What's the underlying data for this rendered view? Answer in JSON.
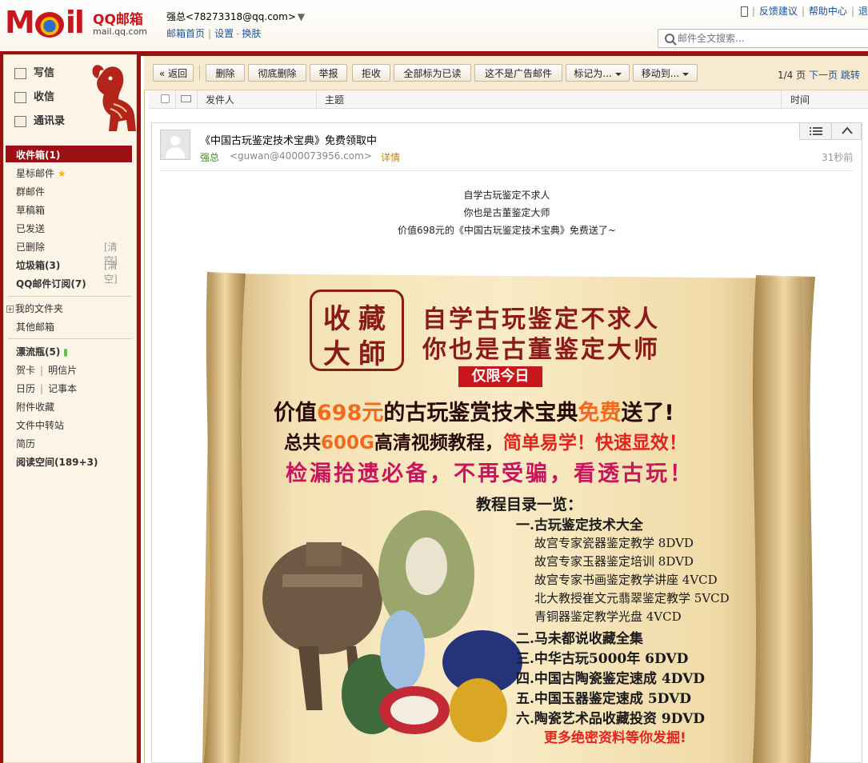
{
  "header": {
    "logo_text_left": "M",
    "logo_text_right": "il",
    "brand_name": "QQ邮箱",
    "brand_url": "mail.qq.com",
    "user_name": "强总",
    "user_email": "<78273318@qq.com>",
    "links": [
      "邮箱首页",
      "设置",
      "换肤"
    ],
    "top_links": [
      "反馈建议",
      "帮助中心",
      "退"
    ],
    "search_placeholder": "邮件全文搜索..."
  },
  "sidebar": {
    "write": "写信",
    "receive": "收信",
    "contacts": "通讯录",
    "inbox": "收件箱(1)",
    "folders": [
      "星标邮件",
      "群邮件",
      "草稿箱",
      "已发送",
      "已删除",
      "垃圾箱(3)",
      "QQ邮件订阅(7)"
    ],
    "clear_label": "[清空]",
    "my_folders": "我的文件夹",
    "other_mailbox": "其他邮箱",
    "bottle": "漂流瓶(5)",
    "card": "贺卡",
    "postcard": "明信片",
    "calendar": "日历",
    "notes": "记事本",
    "attachments": "附件收藏",
    "transfer": "文件中转站",
    "resume": "简历",
    "reading": "阅读空间(189+3)"
  },
  "toolbar": {
    "back": "« 返回",
    "delete": "删除",
    "perm_delete": "彻底删除",
    "report": "举报",
    "reject": "拒收",
    "mark_all_read": "全部标为已读",
    "not_ad": "这不是广告邮件",
    "mark_as": "标记为...",
    "move_to": "移动到...",
    "page": "1/4 页",
    "next_page": "下一页",
    "jump": "跳转"
  },
  "columns": {
    "sender": "发件人",
    "subject": "主题",
    "time": "时间"
  },
  "mail": {
    "subject": "《中国古玩鉴定技术宝典》免费领取中",
    "sender_name": "强总",
    "sender_email": "<guwan@4000073956.com>",
    "detail": "详情",
    "time_ago": "31秒前",
    "body_lines": [
      "自学古玩鉴定不求人",
      "你也是古董鉴定大师",
      "价值698元的《中国古玩鉴定技术宝典》免费送了~"
    ]
  },
  "poster": {
    "seal": [
      "收",
      "藏",
      "大",
      "師"
    ],
    "headline1": "自学古玩鉴定不求人",
    "headline2": "你也是古董鉴定大师",
    "today": "仅限今日",
    "promo1_a": "价值",
    "promo1_b": "698元",
    "promo1_c": "的古玩鉴赏技术宝典",
    "promo1_d": "免费",
    "promo1_e": "送了!",
    "promo2_a": "总共",
    "promo2_b": "600G",
    "promo2_c": "高清视频教程，",
    "promo2_d": "简单易学！快速显效！",
    "promo3": "检漏拾遗必备，不再受骗，看透古玩！",
    "toc_title": "教程目录一览：",
    "toc": [
      "一.古玩鉴定技术大全",
      "故宫专家瓷器鉴定教学 8DVD",
      "故宫专家玉器鉴定培训 8DVD",
      "故宫专家书画鉴定教学讲座 4VCD",
      "北大教授崔文元翡翠鉴定教学 5VCD",
      "青铜器鉴定教学光盘 4VCD",
      "二.马未都说收藏全集",
      "三.中华古玩5000年 6DVD",
      "四.中国古陶瓷鉴定速成 4DVD",
      "五.中国玉器鉴定速成 5DVD",
      "六.陶瓷艺术品收藏投资 9DVD"
    ],
    "more": "更多绝密资料等你发掘!"
  },
  "colors": {
    "brand_red": "#9c0f13",
    "link_blue": "#1e5494",
    "sender_green": "#3a8d1e"
  }
}
